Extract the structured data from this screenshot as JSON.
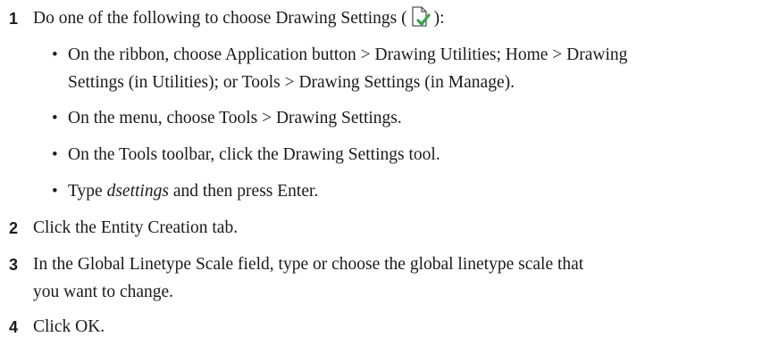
{
  "steps": [
    {
      "number": "1",
      "text_before_icon": "Do one of the following to choose Drawing Settings (",
      "text_after_icon": "):",
      "icon": "drawing-settings-icon",
      "bullets": [
        {
          "line1": "On the ribbon, choose Application button > Drawing Utilities; Home > Drawing",
          "line2": "Settings (in Utilities); or Tools > Drawing Settings (in Manage)."
        },
        {
          "text": "On the menu, choose Tools > Drawing Settings."
        },
        {
          "text": "On the Tools toolbar, click the Drawing Settings tool."
        },
        {
          "prefix": "Type ",
          "command": "dsettings",
          "suffix": " and then press Enter."
        }
      ]
    },
    {
      "number": "2",
      "text": "Click the Entity Creation tab."
    },
    {
      "number": "3",
      "line1": "In the Global Linetype Scale field, type or choose the global linetype scale that",
      "line2": "you want to change."
    },
    {
      "number": "4",
      "text": "Click OK."
    }
  ],
  "colors": {
    "text": "#1a1a1a",
    "icon_check": "#2fa84f",
    "icon_outline": "#555555"
  }
}
